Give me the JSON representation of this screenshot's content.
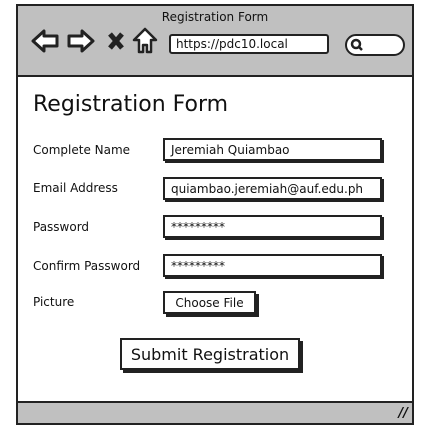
{
  "browser": {
    "title": "Registration Form",
    "url": "https://pdc10.local"
  },
  "form": {
    "heading": "Registration Form",
    "fields": [
      {
        "label": "Complete Name",
        "value": "Jeremiah Quiambao"
      },
      {
        "label": "Email Address",
        "value": "quiambao.jeremiah@auf.edu.ph"
      },
      {
        "label": "Password",
        "value": "*********"
      },
      {
        "label": "Confirm Password",
        "value": "*********"
      }
    ],
    "picture_label": "Picture",
    "choose_file_label": "Choose File",
    "submit_label": "Submit Registration"
  }
}
